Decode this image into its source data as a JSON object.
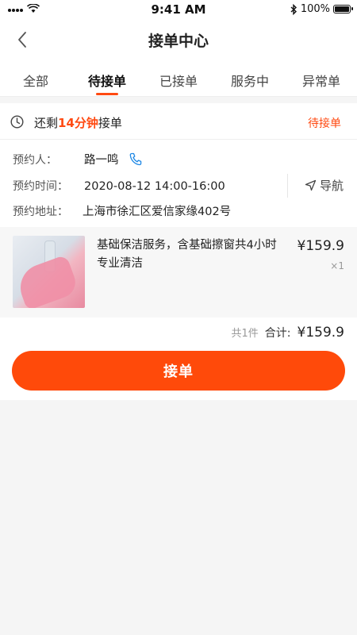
{
  "status_bar": {
    "time": "9:41 AM",
    "battery": "100%",
    "battery_level": 1.0
  },
  "nav": {
    "title": "接单中心",
    "back_icon": "chevron-left-icon"
  },
  "tabs": [
    {
      "label": "全部",
      "active": false
    },
    {
      "label": "待接单",
      "active": true
    },
    {
      "label": "已接单",
      "active": false
    },
    {
      "label": "服务中",
      "active": false
    },
    {
      "label": "异常单",
      "active": false
    }
  ],
  "order": {
    "countdown_prefix": "还剩",
    "countdown_time": "14分钟",
    "countdown_suffix": "接单",
    "status": "待接单",
    "contact_label": "预约人：",
    "contact_name": "路一鸣",
    "time_label": "预约时间：",
    "time_value": "2020-08-12 14:00-16:00",
    "address_label": "预约地址：",
    "address_value": "上海市徐汇区爱信家缘402号",
    "navigate_label": "导航",
    "product": {
      "name": "基础保洁服务，含基础擦窗共4小时专业清洁",
      "price": "¥159.9",
      "qty": "×1"
    },
    "total_count": "共1件",
    "total_label": "合计:",
    "total_amount": "¥159.9",
    "accept_label": "接单"
  },
  "colors": {
    "accent": "#ff4a12",
    "button": "#ff4a0a"
  }
}
